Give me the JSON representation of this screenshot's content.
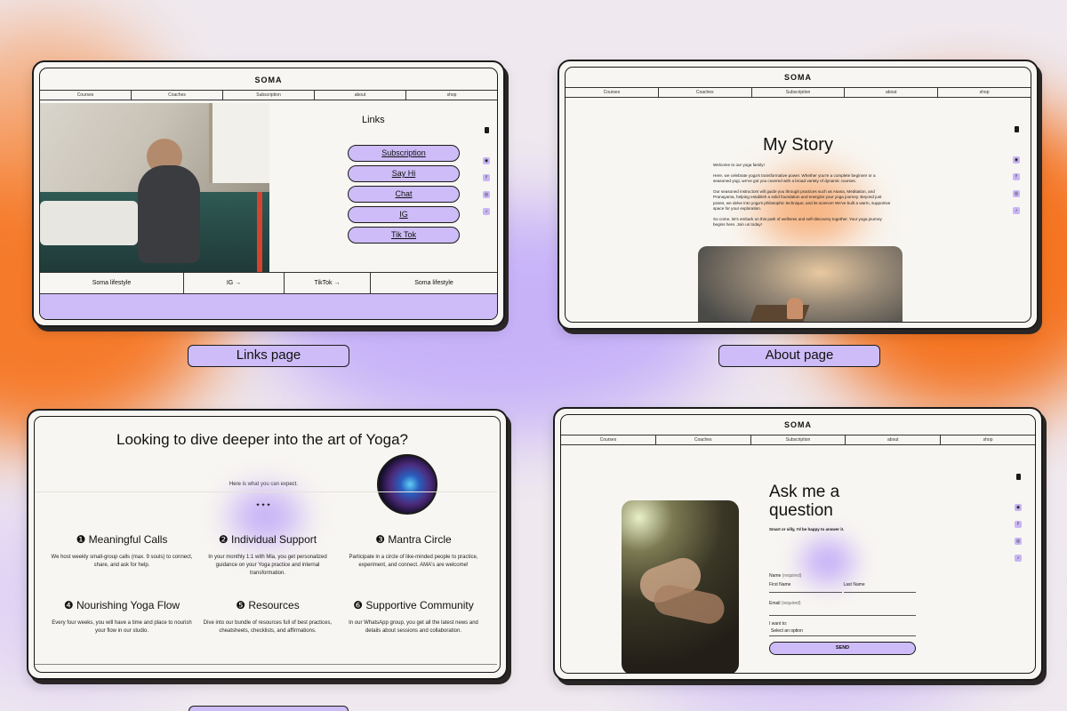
{
  "links_card": {
    "brand": "SOMA",
    "nav": [
      "Courses",
      "Coaches",
      "Subscription",
      "about",
      "shop"
    ],
    "title": "Links",
    "buttons": [
      "Subscription",
      "Say Hi",
      "Chat",
      "IG",
      "Tik Tok"
    ],
    "footer": [
      "Soma lifestyle",
      "IG →",
      "TikTok →",
      "Soma lifestyle"
    ],
    "caption": "Links page"
  },
  "about_card": {
    "brand": "SOMA",
    "nav": [
      "Courses",
      "Coaches",
      "Subscription",
      "about",
      "shop"
    ],
    "title": "My Story",
    "paragraphs": [
      "Welcome to our yoga family!",
      "Here, we celebrate yoga's transformative power. Whether you're a complete beginner or a seasoned yogi, we've got you covered with a broad variety of dynamic courses.",
      "Our seasoned instructors will guide you through practices such as Asana, Meditation, and Pranayama, helping establish a solid foundation and energize your yoga journey. Beyond just poses, we delve into yoga's philosophic technique, and its science! We've built a warm, supportive space for your exploration.",
      "So come, let's embark on this path of wellness and self-discovery together. Your yoga journey begins here. Join us today!"
    ],
    "caption": "About page"
  },
  "features_card": {
    "heading": "Looking to dive deeper into the art of Yoga?",
    "subheading": "Here is what you can expect.",
    "dots": "✦✦✦",
    "features": [
      {
        "title": "❶ Meaningful Calls",
        "text": "We host weekly small-group calls (max. 9 souls) to connect, share, and ask for help."
      },
      {
        "title": "❷ Individual Support",
        "text": "In your monthly 1:1 with Mia, you get personalized guidance on your Yoga practice and internal transformation."
      },
      {
        "title": "❸ Mantra Circle",
        "text": "Participate in a circle of like-minded people to practice, experiment, and connect. AMA's are welcome!"
      },
      {
        "title": "❹ Nourishing Yoga Flow",
        "text": "Every four weeks, you will have a time and place to nourish your flow in our studio."
      },
      {
        "title": "❺ Resources",
        "text": "Dive into our bundle of resources full of best practices, cheatsheets, checklists, and affirmations."
      },
      {
        "title": "❻ Supportive Community",
        "text": "In our WhatsApp group, you get all the latest news and details about sessions and collaboration."
      }
    ]
  },
  "contact_card": {
    "brand": "SOMA",
    "nav": [
      "Courses",
      "Coaches",
      "Subscription",
      "about",
      "shop"
    ],
    "title_line1": "Ask me a",
    "title_line2": "question",
    "subtitle": "Smart or silly, I'd be happy to answer it.",
    "name_label": "Name",
    "required": "(required)",
    "first_name": "First Name",
    "last_name": "Last Name",
    "email_label": "Email",
    "iwant_label": "I want to:",
    "select_value": "Select an option",
    "send": "SEND"
  },
  "colors": {
    "accent": "#cdbcf7",
    "orange": "#f5701e",
    "paper": "#f8f6f2"
  },
  "social_icons": [
    "tiktok-icon",
    "pinterest-icon",
    "facebook-icon",
    "instagram-icon",
    "tiktok-small-icon"
  ]
}
